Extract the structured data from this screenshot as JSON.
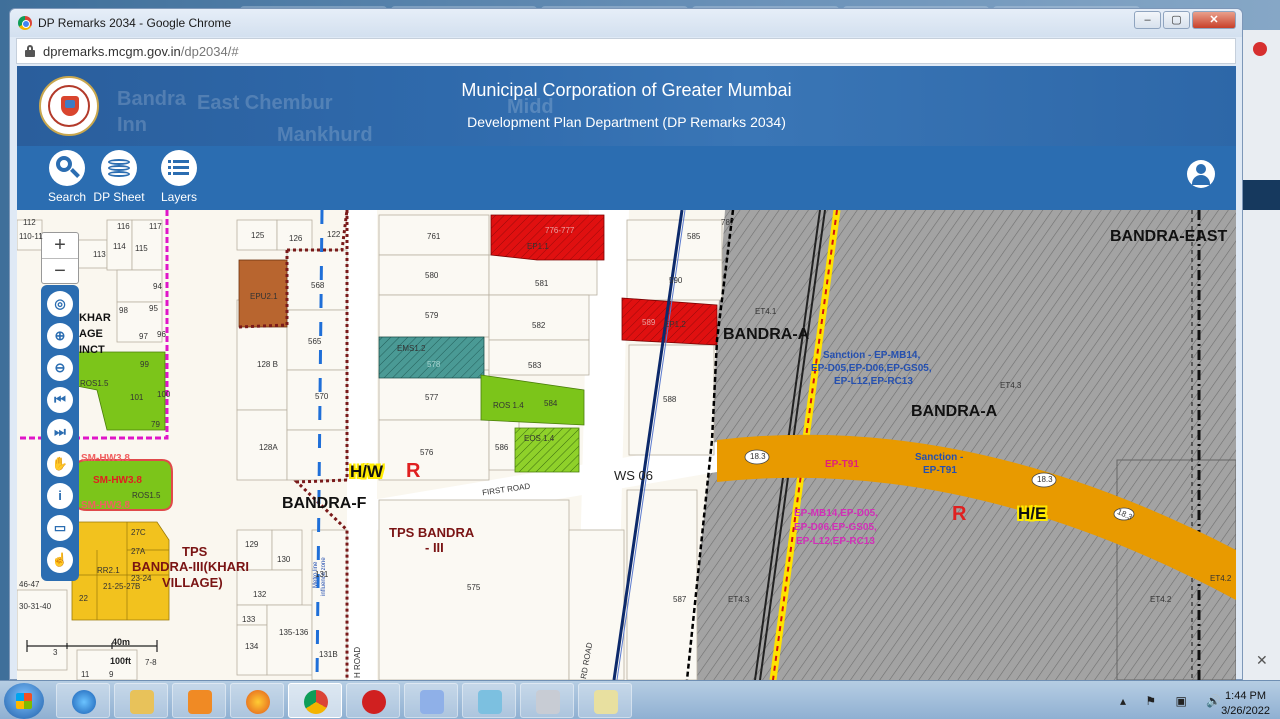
{
  "browser": {
    "tab_title": "DP Remarks 2034 - Google Chrome",
    "url_domain": "dpremarks.mcgm.gov.in",
    "url_path": "/dp2034/#",
    "minimize": "–",
    "maximize": "▢",
    "close": "✕"
  },
  "header": {
    "title": "Municipal Corporation of Greater Mumbai",
    "subtitle": "Development Plan Department (DP Remarks 2034)",
    "bg_places": [
      "Bandra",
      "East Chembur",
      "Mankhurd",
      "Midd",
      "Inn"
    ]
  },
  "toolbar": {
    "search_label": "Search",
    "dpsheet_label": "DP Sheet",
    "layers_label": "Layers"
  },
  "map_controls": {
    "zoom_in": "+",
    "zoom_out": "−"
  },
  "map_labels": {
    "bandra_east": "BANDRA-EAST",
    "bandra_a_1": "BANDRA-A",
    "bandra_a_2": "BANDRA-A",
    "bandra_f": "BANDRA-F",
    "hw": "H/W",
    "he": "H/E",
    "r1": "R",
    "r2": "R",
    "ws06": "WS 06",
    "first_road": "FIRST ROAD",
    "tps_bandra_iii_1": "TPS BANDRA",
    "tps_bandra_iii_2": "- III",
    "tps_khari_1": "TPS",
    "tps_khari_2": "BANDRA-III(KHARI",
    "tps_khari_3": "VILLAGE)",
    "khar_1": "KHAR",
    "khar_2": "AGE",
    "khar_3": "INCT",
    "sanction_1_l1": "Sanction - EP-MB14,",
    "sanction_1_l2": "EP-D05,EP-D06,EP-GS05,",
    "sanction_1_l3": "EP-L12,EP-RC13",
    "sanction_2_l1": "Sanction -",
    "sanction_2_l2": "EP-T91",
    "ep_t91": "EP-T91",
    "pink_l1": "EP-MB14,EP-D05,",
    "pink_l2": "EP-D06,EP-GS05,",
    "pink_l3": "EP-L12,EP-RC13",
    "sm_hw38": "SM-HW3.8",
    "sm_hw38_top": "SM-HW3.8",
    "sm_hw38_bottom": "SM-HW3.8",
    "eps_1": "EP1.1",
    "eps_2": "EP1.2",
    "epu": "EPU2.1",
    "ems": "EMS1.2",
    "ros14": "ROS 1.4",
    "eos14": "EOS 1.4",
    "ros15a": "ROS1.5",
    "ros15b": "ROS1.5",
    "rr21": "RR2.1",
    "et41": "ET4.1",
    "et43a": "ET4.3",
    "et43b": "ET4.3",
    "et42a": "ET4.2",
    "et42b": "ET4.2",
    "road_183a": "18.3",
    "road_183b": "18.3",
    "road_183c": "18.3",
    "metro_l1": "Metro line",
    "metro_l2": "influence zone",
    "road_h": "H ROAD",
    "road_rd": "RD ROAD",
    "scale_40m": "40m",
    "scale_100ft": "100ft",
    "plots": [
      "761",
      "580",
      "579",
      "577",
      "576",
      "581",
      "582",
      "583",
      "584",
      "586",
      "585",
      "588",
      "587",
      "575",
      "568",
      "565",
      "570",
      "125",
      "126",
      "128 B",
      "128A",
      "129",
      "130",
      "131",
      "132",
      "133",
      "134",
      "135-136",
      "131B",
      "122",
      "113",
      "114",
      "115",
      "116",
      "117",
      "112",
      "110-11",
      "94",
      "95",
      "96",
      "97",
      "98",
      "99",
      "79",
      "101",
      "100",
      "27C",
      "27A",
      "23-24",
      "22",
      "21-25-27B",
      "46-47",
      "30-31-40",
      "3",
      "11",
      "9",
      "7-8",
      "776-777",
      "787",
      "590",
      "589",
      "578"
    ]
  },
  "taskbar": {
    "time": "1:44 PM",
    "date": "3/26/2022"
  },
  "colors": {
    "header_blue": "#2b6db1",
    "orange_road": "#e89a00",
    "red_plot": "#e01010",
    "green_plot": "#7cc51a",
    "yellow_plot": "#f2c21e",
    "teal_plot": "#3b8f8a",
    "brown_plot": "#b8652f",
    "grey_zone": "#9e9e9e"
  }
}
